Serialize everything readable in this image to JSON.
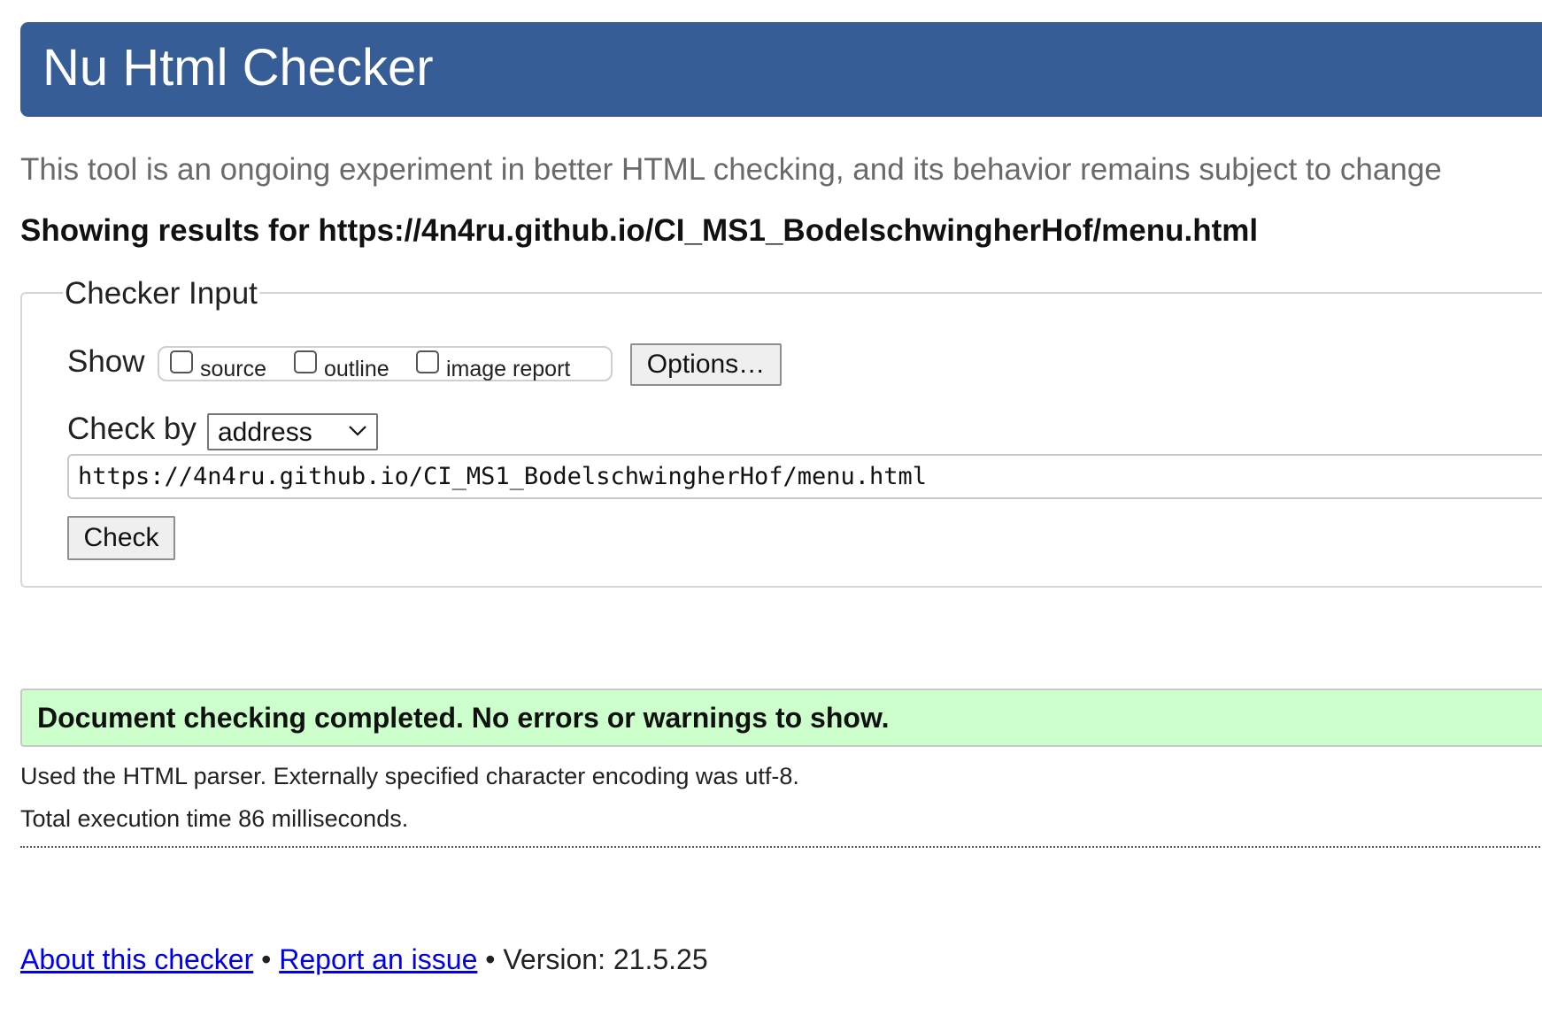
{
  "header": {
    "title": "Nu Html Checker",
    "background_color": "#365d95"
  },
  "tagline": "This tool is an ongoing experiment in better HTML checking, and its behavior remains subject to change",
  "results_heading": "Showing results for https://4n4ru.github.io/CI_MS1_BodelschwingherHof/menu.html",
  "checker_input": {
    "legend": "Checker Input",
    "show_label": "Show",
    "show_options": [
      {
        "label": "source",
        "checked": false
      },
      {
        "label": "outline",
        "checked": false
      },
      {
        "label": "image report",
        "checked": false
      }
    ],
    "options_button": "Options…",
    "check_by_label": "Check by",
    "check_by_selected": "address",
    "url_value": "https://4n4ru.github.io/CI_MS1_BodelschwingherHof/menu.html",
    "check_button": "Check"
  },
  "result": {
    "message": "Document checking completed. No errors or warnings to show.",
    "background_color": "#ccffcc",
    "parser_info": "Used the HTML parser. Externally specified character encoding was utf-8.",
    "execution_time": "Total execution time 86 milliseconds."
  },
  "footer": {
    "about_link": "About this checker",
    "separator": "•",
    "report_link": "Report an issue",
    "version": "Version: 21.5.25",
    "link_color": "#0000ee"
  }
}
